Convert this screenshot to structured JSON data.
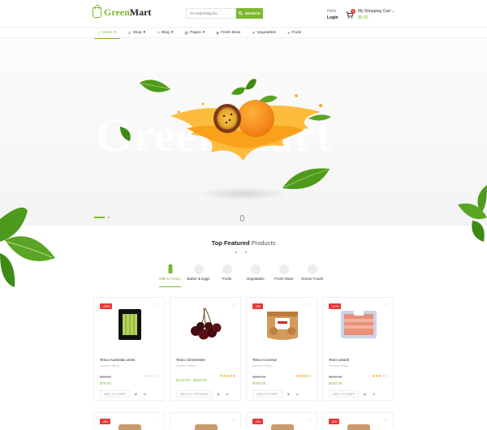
{
  "brand": {
    "name_green": "Green",
    "name_dark": "Mart"
  },
  "search": {
    "placeholder": "I'm searching for...",
    "button_label": "SEARCH"
  },
  "account": {
    "greeting": "Hello",
    "login_label": "Login"
  },
  "cart": {
    "count": "0",
    "title": "My Shopping Cart",
    "total": "$0.00"
  },
  "nav": [
    {
      "label": "Home",
      "icon": "home-icon",
      "active": true
    },
    {
      "label": "Shop",
      "icon": "cart-icon",
      "active": false
    },
    {
      "label": "Blog",
      "icon": "pencil-icon",
      "active": false
    },
    {
      "label": "Pages",
      "icon": "grid-icon",
      "active": false
    },
    {
      "label": "Fresh Meat",
      "icon": "meat-icon",
      "active": false
    },
    {
      "label": "Vegetables",
      "icon": "leaf-icon",
      "active": false
    },
    {
      "label": "Fruits",
      "icon": "apple-icon",
      "active": false
    }
  ],
  "hero": {
    "bg_text": "GreenMart"
  },
  "section": {
    "title_bold": "Top Featured",
    "title_light": "Products"
  },
  "categories": [
    {
      "label": "Milk & Cream",
      "active": true
    },
    {
      "label": "Butter & Eggs",
      "active": false
    },
    {
      "label": "Fruits",
      "active": false
    },
    {
      "label": "Vegetables",
      "active": false
    },
    {
      "label": "Fresh Meat",
      "active": false
    },
    {
      "label": "Ocean Foods",
      "active": false
    }
  ],
  "products": [
    {
      "badge": "-29%",
      "name": "Tesco Australia Limes",
      "category": "Dessert Milky",
      "old_price": "$98.00",
      "new_price": "$78.00",
      "rating": 0,
      "action": "ADD TO CART"
    },
    {
      "badge": "",
      "name": "Tesco Clementine",
      "category": "Dessert Milky",
      "old_price": "",
      "new_price": "$120.00 – $160.00",
      "rating": 5,
      "action": "SELECT OPTIONS"
    },
    {
      "badge": "-9%",
      "name": "Tesco Coconut",
      "category": "Dessert Milky",
      "old_price": "$800.00",
      "new_price": "$750.00",
      "rating": 4,
      "action": "ADD TO CART"
    },
    {
      "badge": "-17%",
      "name": "Tesco peach",
      "category": "Dessert Milky",
      "old_price": "$200.00",
      "new_price": "$160.00",
      "rating": 3,
      "action": "ADD TO CART"
    }
  ],
  "row2_badges": [
    "-8%",
    "",
    "-9%",
    "-8%"
  ],
  "colors": {
    "accent": "#7cb82f",
    "sale": "#e53935",
    "star": "#f5a623"
  }
}
